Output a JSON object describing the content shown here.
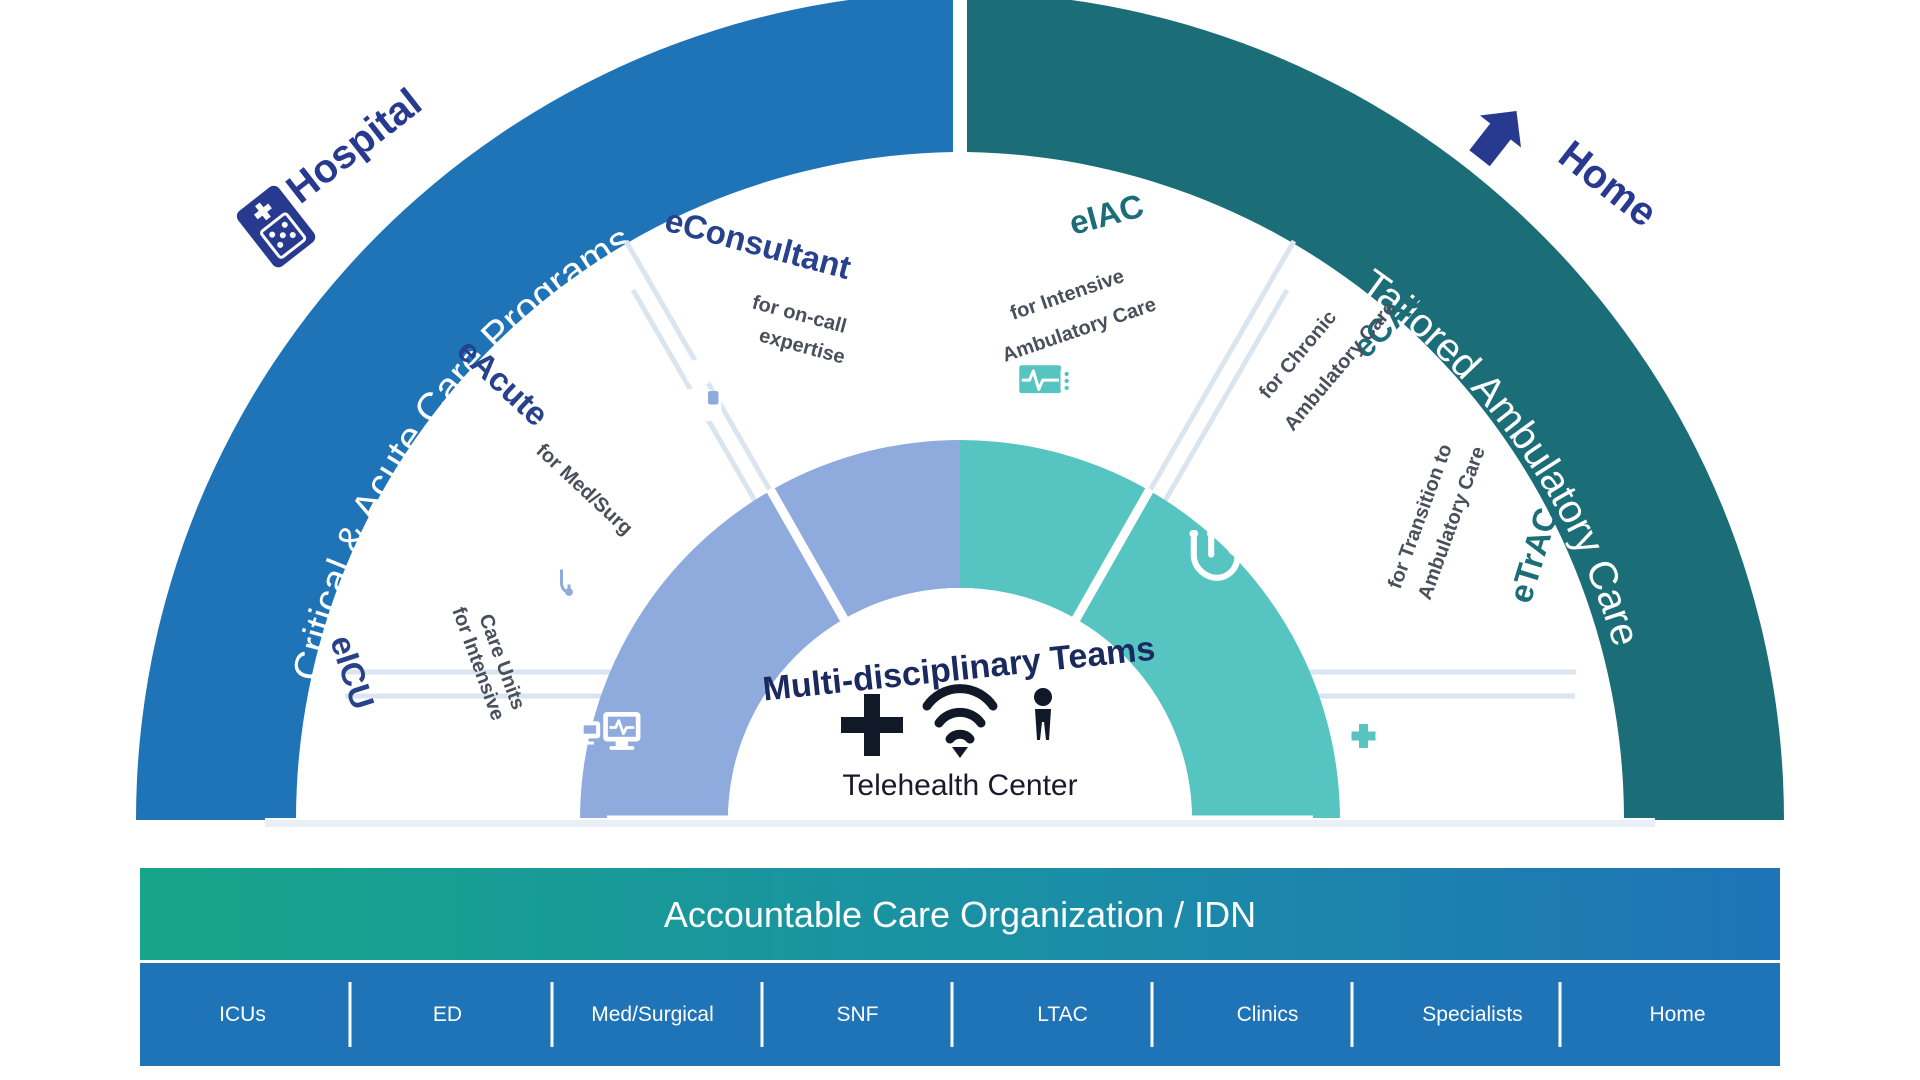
{
  "diagram": {
    "outer_arcs": [
      {
        "id": "left",
        "label": "Critical & Acute Care Programs",
        "color": "#1f73b7",
        "corner_label": "Hospital",
        "corner_color": "#273a8f",
        "corner_icon": "hospital-icon"
      },
      {
        "id": "right",
        "label": "Tailored Ambulatory Care",
        "color": "#1b6d78",
        "corner_label": "Home",
        "corner_color": "#273a8f",
        "corner_icon": "home-arrow-icon"
      }
    ],
    "sectors": [
      {
        "id": "eicu",
        "name": "eICU",
        "subtitle": "for Intensive\nCare Units",
        "subtitle_lines": [
          "for Intensive",
          "Care Units"
        ],
        "name_color": "#27418c",
        "icon": "monitor-vitals-icon",
        "inner_color": "#8fabdd"
      },
      {
        "id": "eacute",
        "name": "eAcute",
        "subtitle_lines": [
          "for Med/Surg"
        ],
        "name_color": "#27418c",
        "icon": "doctor-stethoscope-icon",
        "inner_color": "#8fabdd"
      },
      {
        "id": "econsultant",
        "name": "eConsultant",
        "subtitle_lines": [
          "for on-call",
          "expertise"
        ],
        "name_color": "#27418c",
        "icon": "clinician-icon",
        "inner_color": "#8fabdd"
      },
      {
        "id": "eiac",
        "name": "eIAC",
        "subtitle_lines": [
          "for Intensive",
          "Ambulatory Care"
        ],
        "name_color": "#1b6d78",
        "icon": "patient-monitor-icon",
        "inner_color": "#56c4c0"
      },
      {
        "id": "ecac",
        "name": "eCAC",
        "subtitle_lines": [
          "for Chronic",
          "Ambulatory Care"
        ],
        "name_color": "#1b6d78",
        "icon": "stethoscope-icon",
        "inner_color": "#56c4c0"
      },
      {
        "id": "etrac",
        "name": "eTrAC",
        "subtitle_lines": [
          "for Transition to",
          "Ambulatory Care"
        ],
        "name_color": "#1b6d78",
        "icon": "home-plus-icon",
        "inner_color": "#56c4c0"
      }
    ],
    "core": {
      "title": "Multi-disciplinary Teams",
      "subtitle": "Telehealth Center",
      "icons": [
        "plus-icon",
        "wifi-icon",
        "person-icon"
      ]
    },
    "bars": {
      "primary": {
        "label": "Accountable Care Organization / IDN",
        "color_left": "#17a589",
        "color_right": "#1f73b7"
      },
      "secondary": {
        "color": "#1f73b7",
        "items": [
          "ICUs",
          "ED",
          "Med/Surgical",
          "SNF",
          "LTAC",
          "Clinics",
          "Specialists",
          "Home"
        ]
      }
    },
    "colors": {
      "hospital_blue": "#1f73b7",
      "hospital_inner": "#8fabdd",
      "home_teal": "#1b6d78",
      "home_inner": "#56c4c0",
      "navy": "#27418c",
      "core_white": "#ffffff",
      "spoke": "#dbe5f0",
      "aco_green": "#17a589"
    }
  }
}
